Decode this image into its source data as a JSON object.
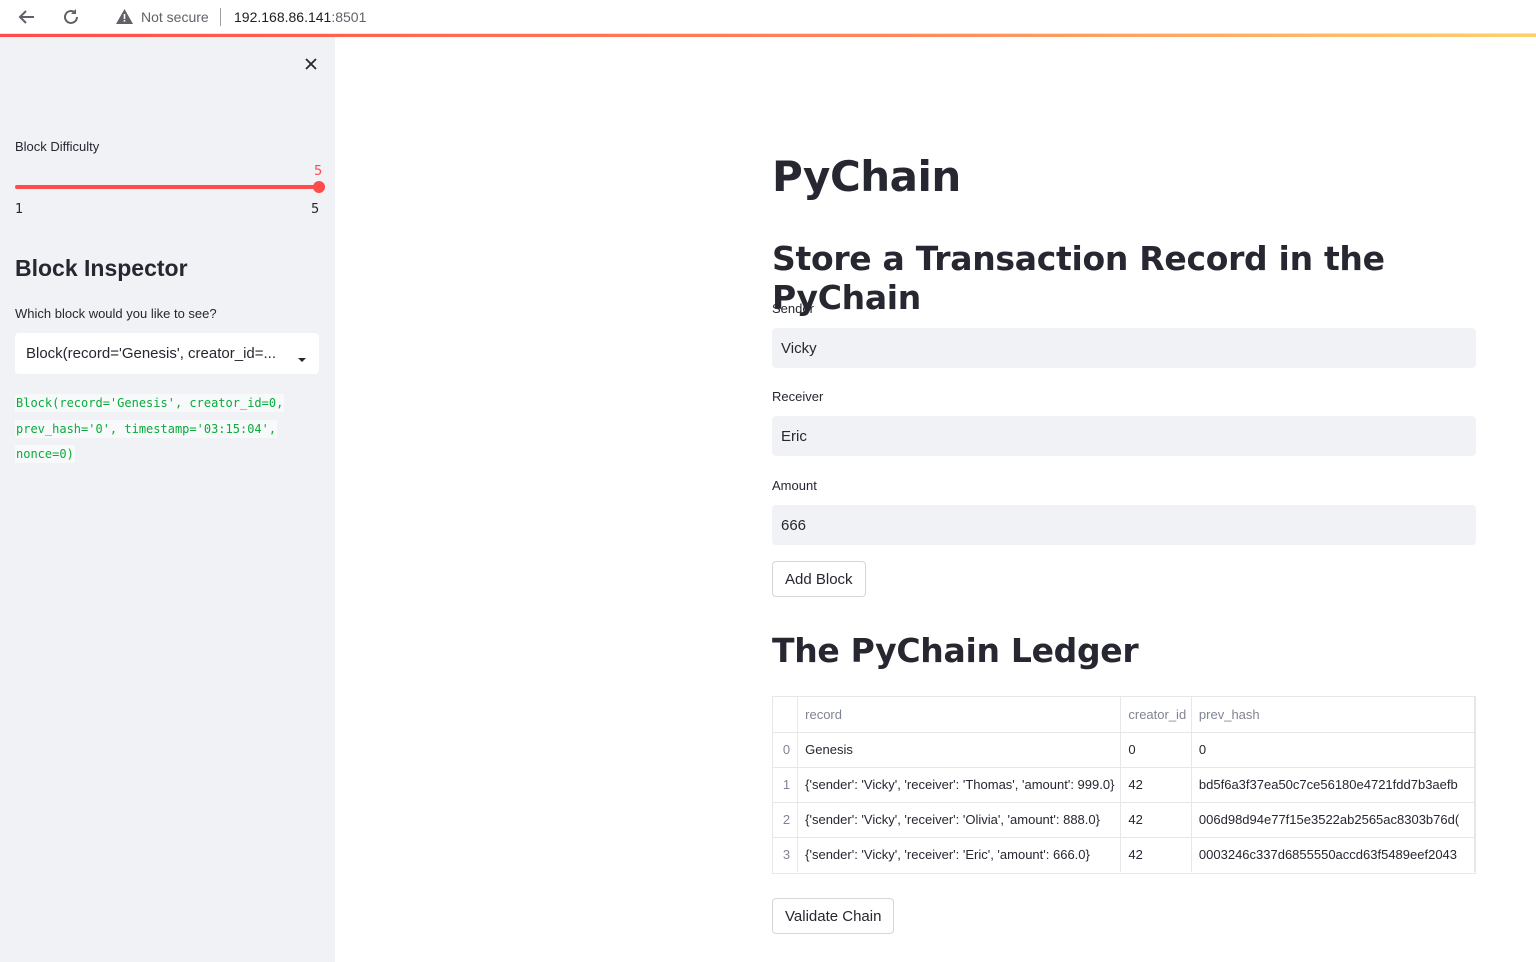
{
  "browser": {
    "security_label": "Not secure",
    "host": "192.168.86.141",
    "port": ":8501"
  },
  "sidebar": {
    "slider": {
      "label": "Block Difficulty",
      "value": "5",
      "min": "1",
      "max": "5",
      "accent_color": "#ff4b4b"
    },
    "inspector_title": "Block Inspector",
    "select_label": "Which block would you like to see?",
    "select_value": "Block(record='Genesis', creator_id=...",
    "code_lines": [
      "Block(record='Genesis', creator_id=0,",
      "prev_hash='0', timestamp='03:15:04',",
      "nonce=0)"
    ]
  },
  "main": {
    "title": "PyChain",
    "section_title": "Store a Transaction Record in the PyChain",
    "sender": {
      "label": "Sender",
      "value": "Vicky"
    },
    "receiver": {
      "label": "Receiver",
      "value": "Eric"
    },
    "amount": {
      "label": "Amount",
      "value": "666"
    },
    "add_block_label": "Add Block",
    "ledger_title": "The PyChain Ledger",
    "ledger": {
      "columns": [
        "",
        "record",
        "creator_id",
        "prev_hash"
      ],
      "rows": [
        [
          "0",
          "Genesis",
          "0",
          "0"
        ],
        [
          "1",
          "{'sender': 'Vicky', 'receiver': 'Thomas', 'amount': 999.0}",
          "42",
          "bd5f6a3f37ea50c7ce56180e4721fdd7b3aefb"
        ],
        [
          "2",
          "{'sender': 'Vicky', 'receiver': 'Olivia', 'amount': 888.0}",
          "42",
          "006d98d94e77f15e3522ab2565ac8303b76d("
        ],
        [
          "3",
          "{'sender': 'Vicky', 'receiver': 'Eric', 'amount': 666.0}",
          "42",
          "0003246c337d6855550accd63f5489eef2043"
        ]
      ]
    },
    "validate_label": "Validate Chain"
  }
}
